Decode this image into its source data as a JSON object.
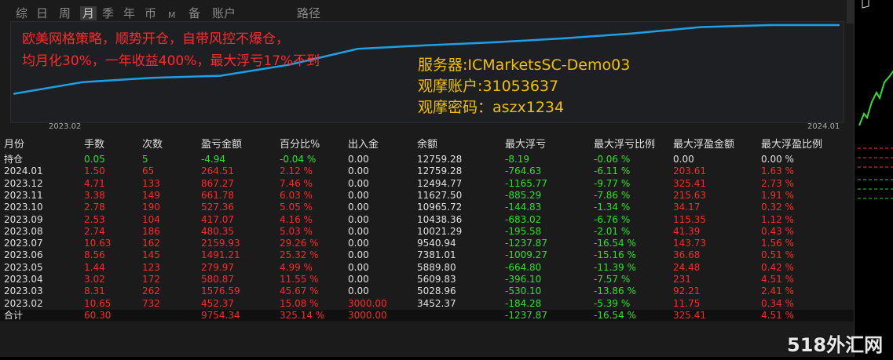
{
  "tabs": [
    "综",
    "日",
    "周",
    "月",
    "季",
    "年",
    "币",
    "M",
    "备",
    "账户",
    "路径"
  ],
  "active_tab": "月",
  "promo": {
    "line1": "欧美网格策略，顺势开仓，自带风控不爆仓，",
    "line2": "均月化30%，一年收益400%，最大浮亏17%不到"
  },
  "info": {
    "server": "服务器:ICMarketsSC-Demo03",
    "account": "观摩账户:31053637",
    "password": "观摩密码：aszx1234"
  },
  "chart": {
    "x_start_label": "2023.02",
    "x_end_label": "2024.01",
    "line_color": "#1ea0e6",
    "balance_series": [
      3452.37,
      5028.96,
      5609.83,
      5889.8,
      7381.01,
      9540.94,
      10021.29,
      10438.36,
      10965.72,
      11627.5,
      12494.77,
      12759.28,
      12759.28
    ]
  },
  "table": {
    "columns": [
      "月份",
      "手数",
      "次数",
      "盈亏金额",
      "百分比%",
      "出入金",
      "余额",
      "最大浮亏",
      "最大浮亏比例",
      "最大浮盈金额",
      "最大浮盈比例"
    ],
    "colors": {
      "default": "#e0e0e0",
      "lots": "#ff2a2a",
      "green": "#2ee02e",
      "red": "#ff2a2a"
    },
    "rows": [
      {
        "m": "持仓",
        "lots": "0.05",
        "cnt": "5",
        "pl": "-4.94",
        "pct": "-0.04 %",
        "io": "0.00",
        "bal": "12759.28",
        "dd": "-8.19",
        "ddp": "-0.06 %",
        "fp": "0.00",
        "fpp": "0.00 %",
        "hold": true
      },
      {
        "m": "2024.01",
        "lots": "1.50",
        "cnt": "65",
        "pl": "264.51",
        "pct": "2.12 %",
        "io": "0.00",
        "bal": "12759.28",
        "dd": "-764.63",
        "ddp": "-6.11 %",
        "fp": "203.61",
        "fpp": "1.63 %"
      },
      {
        "m": "2023.12",
        "lots": "4.71",
        "cnt": "133",
        "pl": "867.27",
        "pct": "7.46 %",
        "io": "0.00",
        "bal": "12494.77",
        "dd": "-1165.77",
        "ddp": "-9.77 %",
        "fp": "325.41",
        "fpp": "2.73 %"
      },
      {
        "m": "2023.11",
        "lots": "3.38",
        "cnt": "149",
        "pl": "661.78",
        "pct": "6.03 %",
        "io": "0.00",
        "bal": "11627.50",
        "dd": "-885.29",
        "ddp": "-7.86 %",
        "fp": "215.63",
        "fpp": "1.91 %"
      },
      {
        "m": "2023.10",
        "lots": "2.78",
        "cnt": "190",
        "pl": "527.36",
        "pct": "5.05 %",
        "io": "0.00",
        "bal": "10965.72",
        "dd": "-144.83",
        "ddp": "-1.34 %",
        "fp": "34.17",
        "fpp": "0.32 %"
      },
      {
        "m": "2023.09",
        "lots": "2.53",
        "cnt": "104",
        "pl": "417.07",
        "pct": "4.16 %",
        "io": "0.00",
        "bal": "10438.36",
        "dd": "-683.02",
        "ddp": "-6.76 %",
        "fp": "115.35",
        "fpp": "1.12 %"
      },
      {
        "m": "2023.08",
        "lots": "2.74",
        "cnt": "186",
        "pl": "480.35",
        "pct": "5.03 %",
        "io": "0.00",
        "bal": "10021.29",
        "dd": "-195.58",
        "ddp": "-2.01 %",
        "fp": "41.39",
        "fpp": "0.43 %"
      },
      {
        "m": "2023.07",
        "lots": "10.63",
        "cnt": "162",
        "pl": "2159.93",
        "pct": "29.26 %",
        "io": "0.00",
        "bal": "9540.94",
        "dd": "-1237.87",
        "ddp": "-16.54 %",
        "fp": "143.73",
        "fpp": "1.56 %"
      },
      {
        "m": "2023.06",
        "lots": "8.56",
        "cnt": "145",
        "pl": "1491.21",
        "pct": "25.32 %",
        "io": "0.00",
        "bal": "7381.01",
        "dd": "-1009.27",
        "ddp": "-15.16 %",
        "fp": "36.68",
        "fpp": "0.51 %"
      },
      {
        "m": "2023.05",
        "lots": "1.44",
        "cnt": "123",
        "pl": "279.97",
        "pct": "4.99 %",
        "io": "0.00",
        "bal": "5889.80",
        "dd": "-664.80",
        "ddp": "-11.39 %",
        "fp": "24.48",
        "fpp": "0.42 %"
      },
      {
        "m": "2023.04",
        "lots": "3.02",
        "cnt": "172",
        "pl": "580.87",
        "pct": "11.55 %",
        "io": "0.00",
        "bal": "5609.83",
        "dd": "-396.10",
        "ddp": "-7.57 %",
        "fp": "231",
        "fpp": "4.51 %"
      },
      {
        "m": "2023.03",
        "lots": "8.31",
        "cnt": "262",
        "pl": "1576.59",
        "pct": "45.67 %",
        "io": "0.00",
        "bal": "5028.96",
        "dd": "-530.10",
        "ddp": "-13.86 %",
        "fp": "92.21",
        "fpp": "2.41 %"
      },
      {
        "m": "2023.02",
        "lots": "10.65",
        "cnt": "732",
        "pl": "452.37",
        "pct": "15.08 %",
        "io": "3000.00",
        "bal": "3452.37",
        "dd": "-184.28",
        "ddp": "-5.39 %",
        "fp": "11.75",
        "fpp": "0.34 %"
      },
      {
        "m": "合计",
        "lots": "60.30",
        "cnt": "",
        "pl": "9754.34",
        "pct": "325.14 %",
        "io": "3000.00",
        "bal": "",
        "dd": "-1237.87",
        "ddp": "-16.54 %",
        "fp": "325.41",
        "fpp": "4.51 %",
        "total": true
      }
    ]
  },
  "watermark": "518外汇网"
}
